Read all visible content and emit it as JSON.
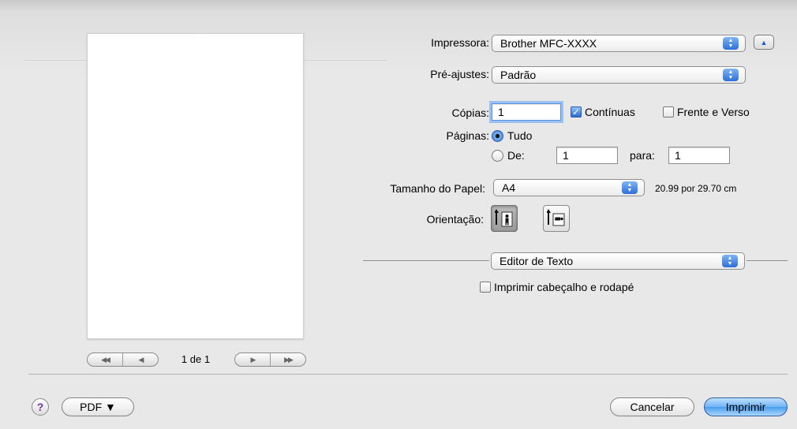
{
  "preview": {
    "page_indicator": "1 de 1",
    "nav": {
      "first_icon": "rewind-to-first-icon",
      "prev_icon": "previous-page-icon",
      "next_icon": "next-page-icon",
      "last_icon": "fast-forward-to-last-icon"
    }
  },
  "printer": {
    "label": "Impressora:",
    "value": "Brother MFC-XXXX",
    "disclosure_icon": "collapse-triangle-icon"
  },
  "presets": {
    "label": "Pré-ajustes:",
    "value": "Padrão"
  },
  "copies": {
    "label": "Cópias:",
    "value": "1",
    "collated_label": "Contínuas",
    "collated_checked": true,
    "duplex_label": "Frente e Verso",
    "duplex_checked": false
  },
  "pages": {
    "label": "Páginas:",
    "all_label": "Tudo",
    "all_selected": true,
    "from_label": "De:",
    "from_value": "1",
    "to_label": "para:",
    "to_value": "1"
  },
  "paper_size": {
    "label": "Tamanho do Papel:",
    "value": "A4",
    "dimensions": "20.99 por 29.70 cm"
  },
  "orientation": {
    "label": "Orientação:",
    "portrait_icon": "portrait-orientation-icon",
    "landscape_icon": "landscape-orientation-icon",
    "selected": "portrait"
  },
  "section": {
    "value": "Editor de Texto",
    "header_footer_label": "Imprimir cabeçalho e rodapé",
    "header_footer_checked": false
  },
  "footer": {
    "help_label": "?",
    "pdf_label": "PDF ▼",
    "cancel_label": "Cancelar",
    "print_label": "Imprimir"
  },
  "colors": {
    "accent": "#3d7fe0",
    "default_button": "#6fb4f5",
    "window_bg": "#e8e8e8"
  }
}
